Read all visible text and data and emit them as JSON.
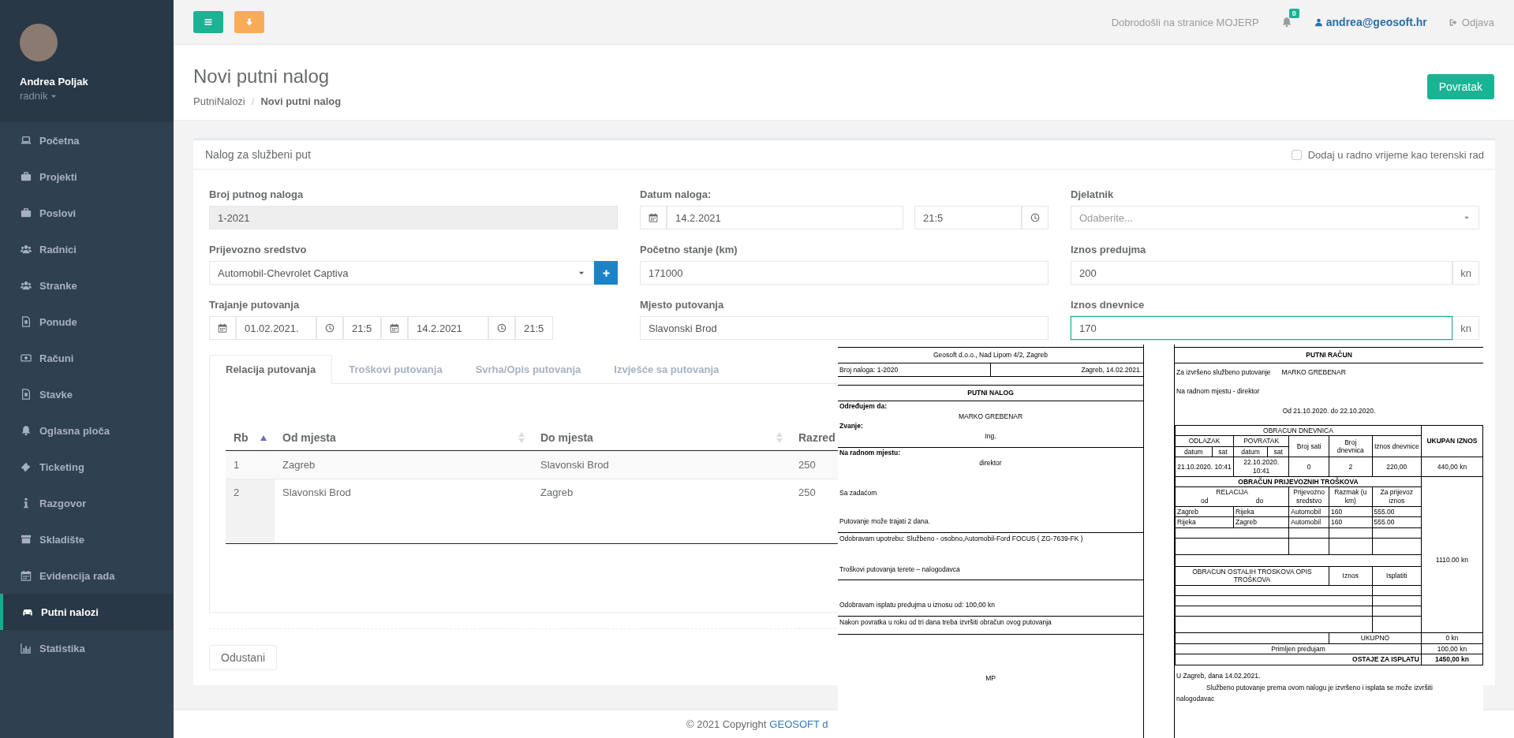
{
  "sidebar": {
    "user_name": "Andrea Poljak",
    "role": "radnik",
    "items": [
      {
        "label": "Početna",
        "selected": false
      },
      {
        "label": "Projekti",
        "selected": false
      },
      {
        "label": "Poslovi",
        "selected": false
      },
      {
        "label": "Radnici",
        "selected": false
      },
      {
        "label": "Stranke",
        "selected": false
      },
      {
        "label": "Ponude",
        "selected": false
      },
      {
        "label": "Računi",
        "selected": false
      },
      {
        "label": "Stavke",
        "selected": false
      },
      {
        "label": "Oglasna ploča",
        "selected": false
      },
      {
        "label": "Ticketing",
        "selected": false
      },
      {
        "label": "Razgovor",
        "selected": false
      },
      {
        "label": "Skladište",
        "selected": false
      },
      {
        "label": "Evidencija rada",
        "selected": false
      },
      {
        "label": "Putni nalozi",
        "selected": true
      },
      {
        "label": "Statistika",
        "selected": false
      }
    ]
  },
  "topbar": {
    "welcome": "Dobrodošli na stranice MOJERP",
    "notification_count": "0",
    "user_email": "andrea@geosoft.hr",
    "logout": "Odjava"
  },
  "page": {
    "title": "Novi putni nalog",
    "breadcrumb": [
      {
        "label": "PutniNalozi",
        "current": false
      },
      {
        "label": "Novi putni nalog",
        "current": true
      }
    ],
    "breadcrumb_separator": "/",
    "back_button": "Povratak"
  },
  "form": {
    "title": "Nalog za službeni put",
    "field_checkbox": {
      "label": "Dodaj u radno vrijeme kao terenski rad",
      "checked": false
    },
    "order_number": {
      "label": "Broj putnog naloga",
      "value": "1-2021",
      "disabled": true
    },
    "vehicle": {
      "label": "Prijevozno sredstvo",
      "value": "Automobil-Chevrolet Captiva"
    },
    "duration": {
      "label": "Trajanje putovanja",
      "start_date": "01.02.2021.",
      "start_time": "21:5",
      "end_date": "14.2.2021",
      "end_time": "21:5"
    },
    "order_date": {
      "label": "Datum naloga:",
      "date": "14.2.2021",
      "time": "21:5"
    },
    "start_km": {
      "label": "Početno stanje (km)",
      "value": "171000"
    },
    "destination": {
      "label": "Mjesto putovanja",
      "value": "Slavonski Brod"
    },
    "employee": {
      "label": "Djelatnik",
      "placeholder": "Odaberite..."
    },
    "advance": {
      "label": "Iznos predujma",
      "value": "200",
      "unit": "kn",
      "focused": false
    },
    "daily_allowance": {
      "label": "Iznos dnevnice",
      "value": "170",
      "unit": "kn",
      "focused": true
    }
  },
  "tabs": [
    {
      "label": "Relacija putovanja",
      "selected": true
    },
    {
      "label": "Troškovi putovanja",
      "selected": false
    },
    {
      "label": "Svrha/Opis putovanja",
      "selected": false
    },
    {
      "label": "Izvješće sa putovanja",
      "selected": false
    }
  ],
  "route_table": {
    "columns": [
      {
        "label": "Rb",
        "sorted": true
      },
      {
        "label": "Od mjesta",
        "sorted": false
      },
      {
        "label": "Do mjesta",
        "sorted": false
      },
      {
        "label": "Razred",
        "sorted": false
      }
    ],
    "rows": [
      [
        "1",
        "Zagreb",
        "Slavonski Brod",
        "250"
      ],
      [
        "2",
        "Slavonski Brod",
        "Zagreb",
        "250"
      ]
    ]
  },
  "cancel_button": "Odustani",
  "footer": {
    "copyright": "© 2021 Copyright",
    "company_link": "GEOSOFT d"
  },
  "print_preview": {
    "travel_order": {
      "company": "Geosoft d.o.o., Nad Lipom 4/2, Zagreb",
      "order_number": "Broj naloga: 1-2020",
      "place_date": "Zagreb, 14.02.2021.",
      "title": "PUTNI NALOG",
      "lines": [
        {
          "kind": "label",
          "text": "Određujem da:"
        },
        {
          "kind": "value",
          "text": "MARKO GREBENAR"
        },
        {
          "kind": "label",
          "text": "Zvanje:"
        },
        {
          "kind": "value",
          "text": "Ing."
        },
        {
          "kind": "rule"
        },
        {
          "kind": "label",
          "text": "Na radnom mjestu:"
        },
        {
          "kind": "value",
          "text": "direktor"
        },
        {
          "kind": "text",
          "text": "Sa zadaćom"
        },
        {
          "kind": "text",
          "text": "Putovanje može trajati 2 dana."
        },
        {
          "kind": "rule"
        },
        {
          "kind": "plain",
          "text": "Odobravam upotrebu: Službeno - osobno,Automobil-Ford FOCUS  ( ZG-7639-FK )"
        },
        {
          "kind": "text",
          "text": "Troškovi putovanja terete – nalogodavca"
        },
        {
          "kind": "rule"
        },
        {
          "kind": "text",
          "text": "Odobravam isplatu predujma u iznosu od: 100,00 kn"
        },
        {
          "kind": "rule"
        },
        {
          "kind": "plain",
          "text": "Nakon povratka u roku od tri dana treba izvršiti obračun ovog putovanja"
        },
        {
          "kind": "rule"
        },
        {
          "kind": "stamp",
          "text": "MP"
        }
      ]
    },
    "travel_invoice": {
      "title": "PUTNI RAČUN",
      "intro": "Za izvršeno službeno putovanje",
      "person": "MARKO GREBENAR",
      "position": "Na radnom mjestu - direktor",
      "period": "Od 21.10.2020. do 22.10.2020.",
      "allowance": {
        "title": "OBRACUN DNEVNICA",
        "departure": "ODLAZAK",
        "return": "POVRATAK",
        "departure_date": "datum",
        "departure_hour": "sat",
        "return_date": "datum",
        "return_hour": "sat",
        "hours": "Broj sati",
        "count": "Broj dnevnica",
        "amount": "Iznos dnevnice",
        "total": "UKUPAN IZNOS",
        "row": {
          "departure": "21.10.2020. 10:41",
          "return": "22.10.2020. 10:41",
          "hours": "0",
          "count": "2",
          "amount": "220,00",
          "total": "440,00 kn"
        }
      },
      "transport": {
        "title": "OBRAČUN PRIJEVOZNIH TROŠKOVA",
        "relation": "RELACIJA",
        "from": "od",
        "to": "do",
        "vehicle": "Prijevozno sredstvo",
        "distance": "Razmak (u km)",
        "amount": "Za prijevoz iznos",
        "rows": [
          [
            "Zagreb",
            "Rijeka",
            "Automobil",
            "160",
            "555.00"
          ],
          [
            "Rijeka",
            "Zagreb",
            "Automobil",
            "160",
            "555.00"
          ]
        ],
        "total": "1110.00 kn"
      },
      "other": {
        "title": "OBRACUN OSTALIH TROSKOVA   OPIS TROŠKOVA",
        "amount": "Iznos",
        "payout": "Isplatiti"
      },
      "sum_label": "UKUPNO",
      "sum": "0 kn",
      "advance_label": "Primljen predujam",
      "advance": "100,00 kn",
      "remaining_label": "OSTAJE ZA ISPLATU",
      "remaining": "1450,00 kn",
      "place_date": "U Zagreb, dana 14.02.2021.",
      "statement": "Službeno putovanje prema ovom nalogu je izvršeno i isplata se može izvršiti",
      "signer": "nalogodavac"
    }
  }
}
